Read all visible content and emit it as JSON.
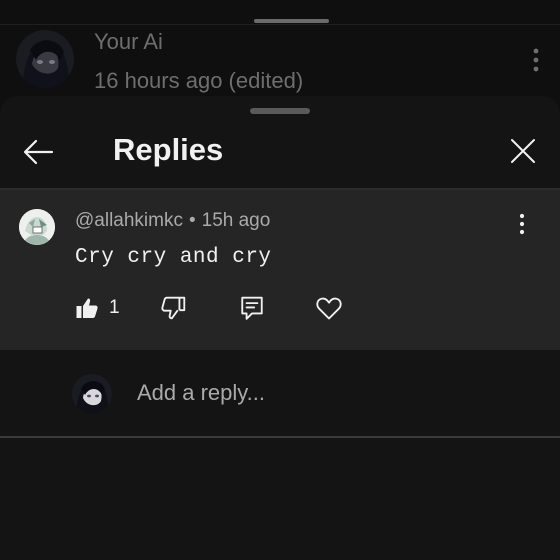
{
  "background_comment": {
    "author": "Your Ai",
    "time": "16 hours ago (edited)",
    "avatar_icon": "anime-avatar-icon",
    "menu_icon": "more-vert-icon"
  },
  "sheet": {
    "title": "Replies",
    "back_icon": "arrow-left-icon",
    "close_icon": "close-icon"
  },
  "reply": {
    "username": "@allahkimkc",
    "separator": "•",
    "time": "15h ago",
    "text": "Cry cry and cry",
    "like_count": "1",
    "icons": [
      "thumb-up-icon",
      "thumb-down-icon",
      "comment-reply-icon",
      "heart-icon",
      "more-vert-icon"
    ]
  },
  "add_reply": {
    "placeholder": "Add a reply..."
  },
  "colors": {
    "background": "#0f0f0f",
    "card": "#252525",
    "text": "#f1f1f1",
    "muted": "#aaaaaa"
  }
}
